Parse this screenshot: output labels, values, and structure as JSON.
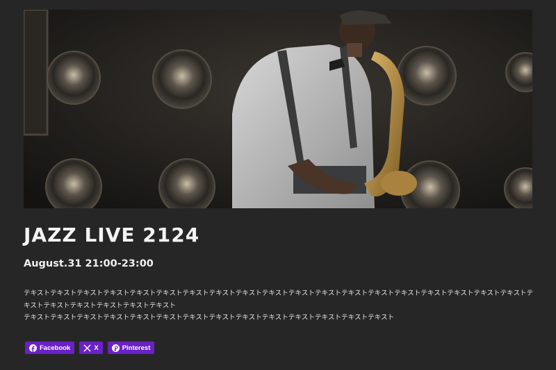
{
  "event": {
    "title": "JAZZ LIVE 2124",
    "datetime": "August.31 21:00-23:00",
    "description_lines": [
      "テキストテキストテキストテキストテキストテキストテキストテキストテキストテキストテキストテキストテキストテキストテキストテキストテキストテキストテキストテキストテキストテキストテキストテキストテキスト",
      "テキストテキストテキストテキストテキストテキストテキストテキストテキストテキストテキストテキストテキストテキスト"
    ]
  },
  "hero": {
    "icon": "saxophone-player-photo"
  },
  "share": {
    "accent": "#6b21c8",
    "buttons": [
      {
        "label": "Facebook",
        "icon": "facebook-icon"
      },
      {
        "label": "X",
        "icon": "x-icon"
      },
      {
        "label": "Pinterest",
        "icon": "pinterest-icon"
      }
    ]
  }
}
